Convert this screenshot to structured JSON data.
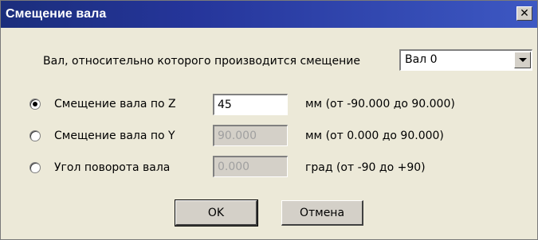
{
  "window": {
    "title": "Смещение вала",
    "close_glyph": "✕"
  },
  "shaft_select": {
    "label": "Вал, относительно которого производится смещение",
    "value": "Вал 0"
  },
  "options": [
    {
      "label": "Смещение вала по Z",
      "selected": true,
      "value": "45",
      "enabled": true,
      "range": "мм (от -90.000 до 90.000)"
    },
    {
      "label": "Смещение вала по Y",
      "selected": false,
      "value": "90.000",
      "enabled": false,
      "range": "мм (от 0.000 до 90.000)"
    },
    {
      "label": "Угол поворота вала",
      "selected": false,
      "value": "0.000",
      "enabled": false,
      "range": "град (от -90 до +90)"
    }
  ],
  "buttons": {
    "ok": "OK",
    "cancel": "Отмена"
  },
  "colors": {
    "titlebar_start": "#1b2e7c",
    "titlebar_end": "#3d58c3",
    "dialog_bg": "#ece9d8"
  }
}
